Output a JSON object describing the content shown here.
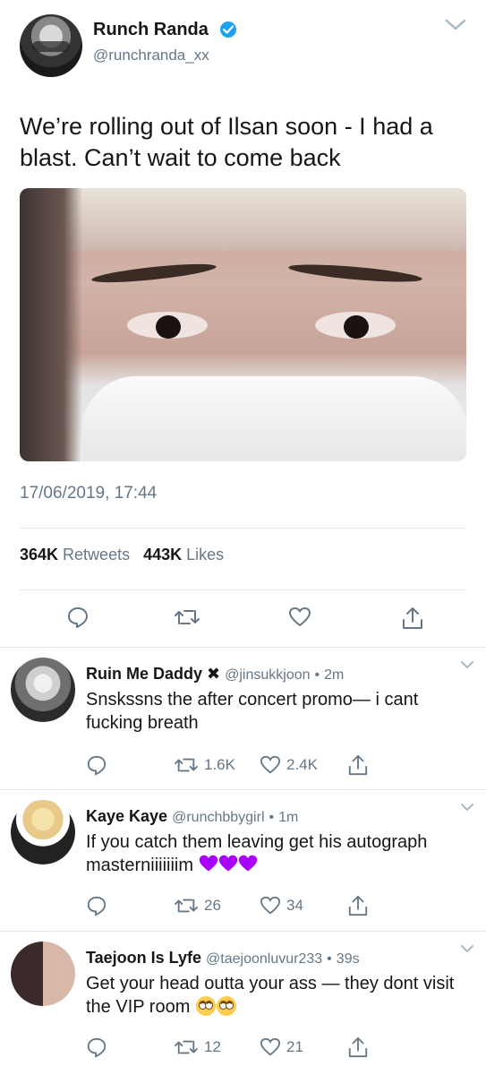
{
  "tweet": {
    "display_name": "Runch Randa",
    "handle": "@runchranda_xx",
    "text": "We’re rolling out of Ilsan soon - I had a blast. Can’t wait to come back",
    "timestamp": "17/06/2019, 17:44",
    "retweets_count": "364K",
    "retweets_label": "Retweets",
    "likes_count": "443K",
    "likes_label": "Likes",
    "verified": true
  },
  "replies": [
    {
      "name": "Ruin Me Daddy ✖",
      "handle": "@jinsukkjoon",
      "time": "2m",
      "text": "Snskssns the after concert promo— i cant fucking breath",
      "retweets": "1.6K",
      "likes": "2.4K"
    },
    {
      "name": "Kaye Kaye",
      "handle": "@runchbbygirl",
      "time": "1m",
      "text": "If you catch them leaving get his autograph masterniiiiiiim",
      "retweets": "26",
      "likes": "34"
    },
    {
      "name": "Taejoon Is Lyfe",
      "handle": "@taejoonluvur233",
      "time": "39s",
      "text": "Get your head outta your ass — they dont visit the VIP room",
      "retweets": "12",
      "likes": "21"
    }
  ],
  "meta_separator": "•",
  "icons": {
    "verified": "verified-badge-icon",
    "menu": "chevron-down-icon",
    "reply": "reply-icon",
    "retweet": "retweet-icon",
    "like": "heart-icon",
    "share": "share-icon"
  },
  "colors": {
    "accent": "#1da1f2",
    "text": "#14171a",
    "secondary": "#657786",
    "divider": "#e1e8ed",
    "purple_heart": "#aa00ff"
  }
}
